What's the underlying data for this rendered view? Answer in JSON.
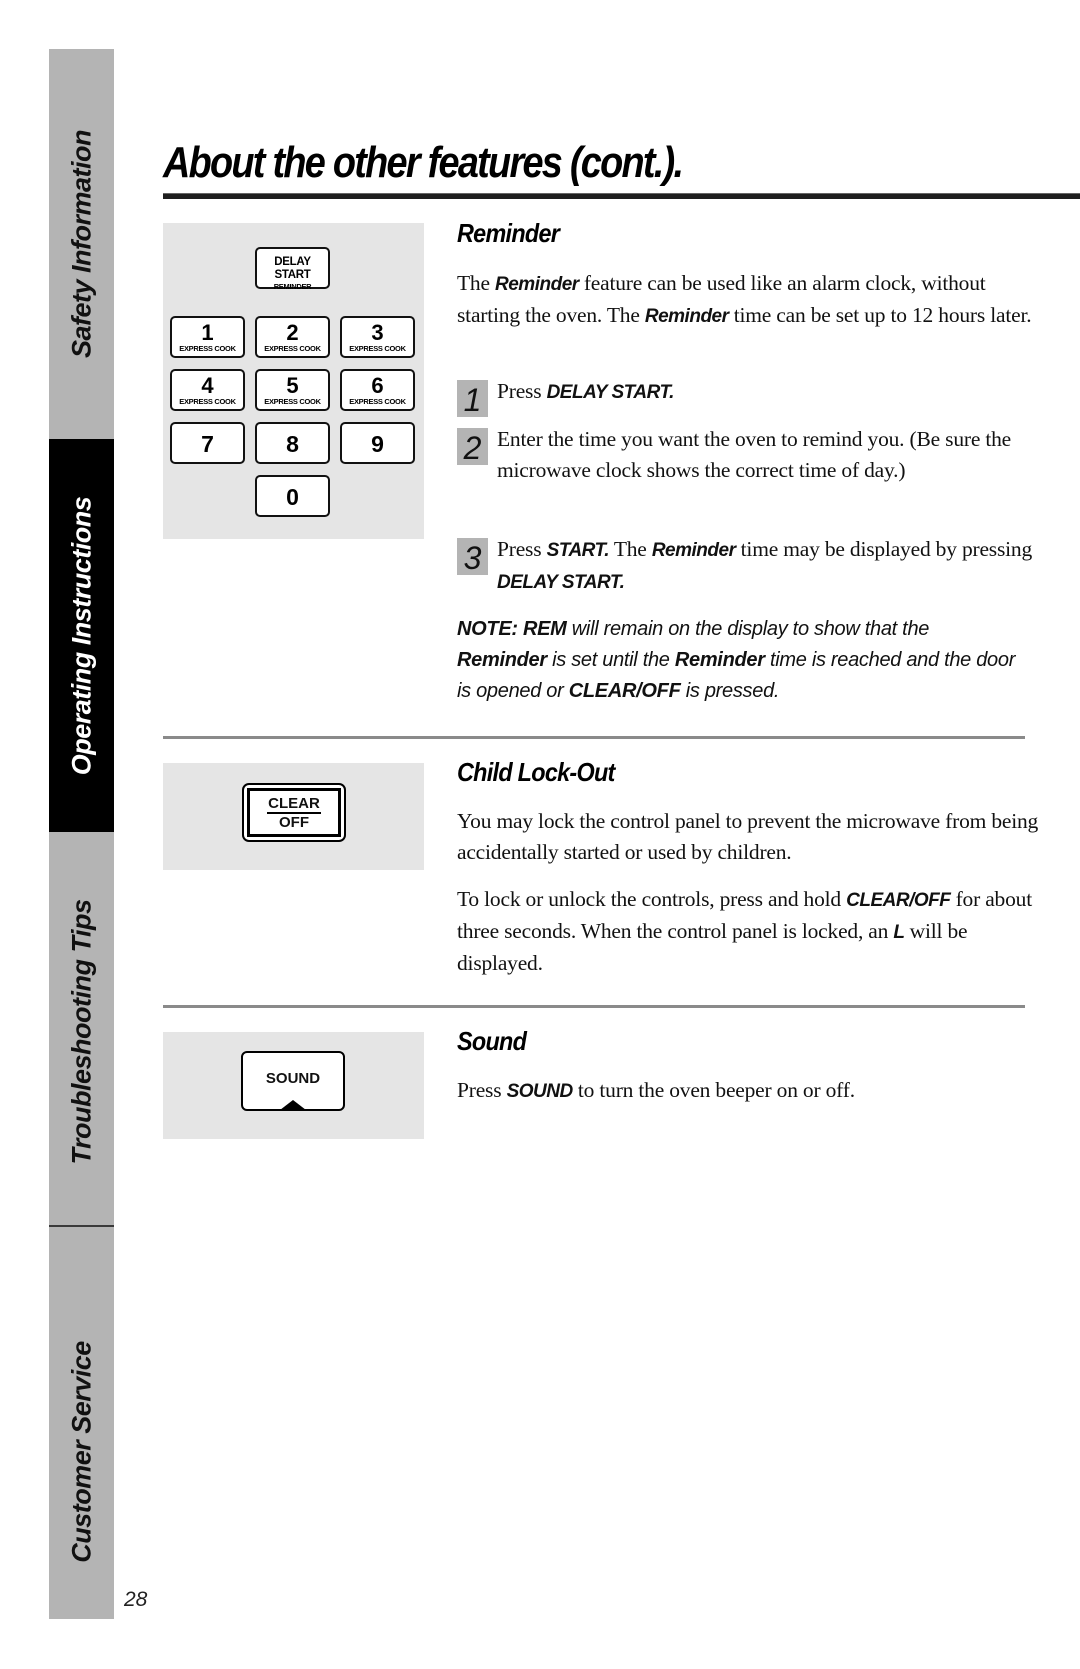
{
  "sidebar": {
    "tabs": [
      {
        "label": "Safety Information",
        "active": false
      },
      {
        "label": "Operating Instructions",
        "active": true
      },
      {
        "label": "Troubleshooting Tips",
        "active": false
      },
      {
        "label": "Customer Service",
        "active": false
      }
    ]
  },
  "page": {
    "title": "About the other features (cont.).",
    "page_number": "28"
  },
  "keypad": {
    "delay_start": {
      "main": "DELAY START",
      "sub": "REMINDER"
    },
    "keys": [
      {
        "num": "1",
        "sub": "EXPRESS COOK"
      },
      {
        "num": "2",
        "sub": "EXPRESS COOK"
      },
      {
        "num": "3",
        "sub": "EXPRESS COOK"
      },
      {
        "num": "4",
        "sub": "EXPRESS COOK"
      },
      {
        "num": "5",
        "sub": "EXPRESS COOK"
      },
      {
        "num": "6",
        "sub": "EXPRESS COOK"
      },
      {
        "num": "7",
        "sub": ""
      },
      {
        "num": "8",
        "sub": ""
      },
      {
        "num": "9",
        "sub": ""
      },
      {
        "num": "0",
        "sub": ""
      }
    ]
  },
  "reminder": {
    "heading": "Reminder",
    "intro": {
      "p1": "The ",
      "b1": "Reminder",
      "p2": " feature can be used like an alarm clock, without starting the oven. The ",
      "b2": "Reminder",
      "p3": " time can be set up to 12 hours later."
    },
    "steps": [
      {
        "n": "1",
        "pre": "Press ",
        "bold": "DELAY START.",
        "post": ""
      },
      {
        "n": "2",
        "pre": "Enter the time you want the oven to remind you. (Be sure the microwave clock shows the correct time of day.)",
        "bold": "",
        "post": ""
      },
      {
        "n": "3",
        "pre": "Press ",
        "bold": "START.",
        "mid": " The ",
        "bold2": "Reminder",
        "mid2": " time may be displayed by pressing ",
        "bold3": "DELAY START."
      }
    ],
    "note": {
      "b1": "NOTE: REM",
      "t1": " will remain on the display to show that the ",
      "b2": "Reminder",
      "t2": " is set until the ",
      "b3": "Reminder",
      "t3": " time is reached and the door is opened or ",
      "b4": "CLEAR/OFF",
      "t4": " is pressed."
    }
  },
  "child_lockout": {
    "heading": "Child Lock-Out",
    "key": {
      "line1": "CLEAR",
      "line2": "OFF"
    },
    "p1": "You may lock the control panel to prevent the microwave from being accidentally started or used by children.",
    "p2": {
      "t1": "To lock or unlock the controls, press and hold ",
      "b1": "CLEAR/OFF",
      "t2": " for about three seconds. When the control panel is locked, an ",
      "b2": "L",
      "t3": " will be displayed."
    }
  },
  "sound": {
    "heading": "Sound",
    "key": {
      "label": "SOUND"
    },
    "p1": {
      "t1": "Press ",
      "b1": "SOUND",
      "t2": " to turn the oven beeper on or off."
    }
  }
}
